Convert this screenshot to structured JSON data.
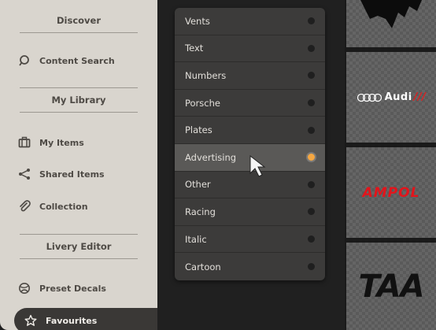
{
  "sidebar": {
    "sections": {
      "discover": "Discover",
      "my_library": "My Library",
      "livery_editor": "Livery Editor"
    },
    "items": [
      {
        "label": "Content Search",
        "icon": "search-icon"
      },
      {
        "label": "My Items",
        "icon": "briefcase-icon"
      },
      {
        "label": "Shared Items",
        "icon": "share-icon"
      },
      {
        "label": "Collection",
        "icon": "paperclip-icon"
      },
      {
        "label": "Preset Decals",
        "icon": "globe-icon"
      },
      {
        "label": "Favourites",
        "icon": "star-icon",
        "active": true
      }
    ]
  },
  "category_menu": {
    "options": [
      {
        "label": "Vents",
        "selected": false
      },
      {
        "label": "Text",
        "selected": false
      },
      {
        "label": "Numbers",
        "selected": false
      },
      {
        "label": "Porsche",
        "selected": false
      },
      {
        "label": "Plates",
        "selected": false
      },
      {
        "label": "Advertising",
        "selected": true
      },
      {
        "label": "Other",
        "selected": false
      },
      {
        "label": "Racing",
        "selected": false
      },
      {
        "label": "Italic",
        "selected": false
      },
      {
        "label": "Cartoon",
        "selected": false
      }
    ],
    "accent_color": "#f5a742"
  },
  "previews": {
    "audi": {
      "brand": "Audi",
      "slashes": "///"
    },
    "ampol": {
      "brand": "AMPOL"
    },
    "taa": {
      "brand": "TAA"
    }
  }
}
